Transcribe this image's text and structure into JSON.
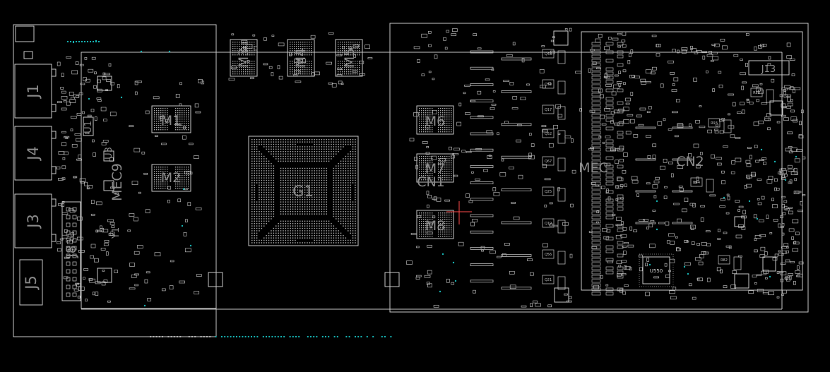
{
  "colors": {
    "background": "#000000",
    "outline": "#c8c8c8",
    "pad": "#b4b4b4",
    "bga": "#a8a8a8",
    "via": "#16b3b3",
    "marker": "#ff4d4d"
  },
  "labels": {
    "j1": "J1",
    "j4": "J4",
    "j3": "J3",
    "j5": "J5",
    "j8": "J8",
    "j13": "J13",
    "m1": "M1",
    "m2": "M2",
    "m3": "M3",
    "m4": "M4",
    "m5": "M5",
    "m6": "M6",
    "m7": "M7",
    "m8": "M8",
    "g1": "G1",
    "cn1": "CN1",
    "cn2": "CN2",
    "mec_left": "MEC9",
    "mec_right": "MEC",
    "u550": "U550",
    "y1": "Y1",
    "u1": "U1",
    "u3": "U3"
  },
  "small_parts": [
    {
      "id": "q1",
      "text": "Q48"
    },
    {
      "id": "q2",
      "text": "Q50"
    },
    {
      "id": "q3",
      "text": "Q17"
    },
    {
      "id": "q4",
      "text": "Q52"
    },
    {
      "id": "q5",
      "text": "Q67"
    },
    {
      "id": "q6",
      "text": "Q25"
    },
    {
      "id": "q7",
      "text": "Q19"
    },
    {
      "id": "q8",
      "text": "Q56"
    },
    {
      "id": "q9",
      "text": "Q21"
    },
    {
      "id": "d1",
      "text": "D44"
    },
    {
      "id": "r1",
      "text": "R93"
    },
    {
      "id": "r2",
      "text": "R83"
    },
    {
      "id": "r3",
      "text": "R82"
    }
  ]
}
